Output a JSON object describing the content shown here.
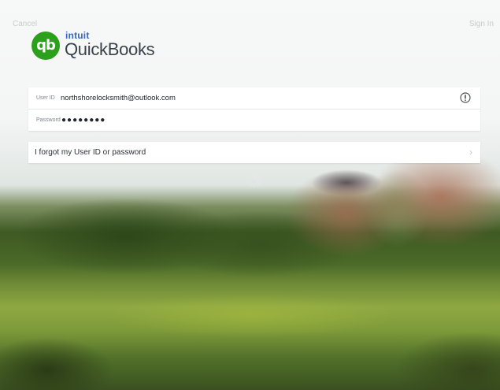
{
  "nav": {
    "cancel_label": "Cancel",
    "signin_label": "Sign In"
  },
  "logo": {
    "badge_text": "qb",
    "intuit_text": "intuit",
    "product_name": "QuickBooks"
  },
  "login": {
    "user_id_label": "User ID",
    "user_id_value": "northshorelocksmith@outlook.com",
    "password_label": "Password",
    "password_value": "●●●●●●●●",
    "info_icon": "info-circle-icon"
  },
  "forgot": {
    "label": "I forgot my User ID or password",
    "chevron_icon": "chevron-right-icon"
  },
  "status": {
    "loading_icon": "loading-spinner-icon"
  },
  "colors": {
    "brand_green": "#2ca01c",
    "intuit_blue": "#3468c8",
    "text_dark": "#22272b"
  }
}
